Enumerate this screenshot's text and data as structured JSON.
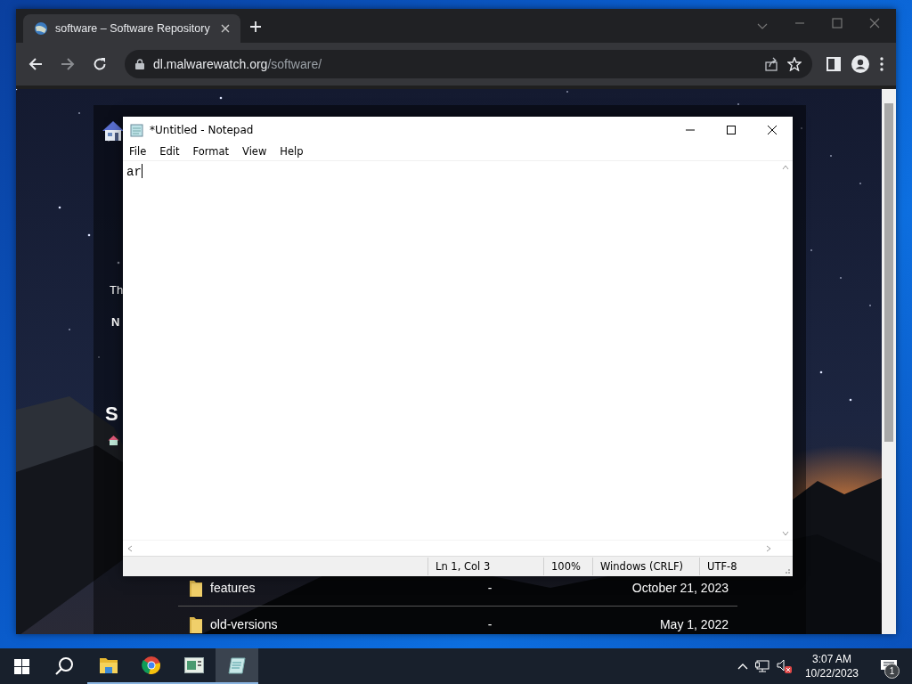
{
  "browser": {
    "tab": {
      "title": "software – Software Repository"
    },
    "address": {
      "host": "dl.malwarewatch.org",
      "path": "/software/"
    }
  },
  "page": {
    "cut_texts": [
      {
        "kind": "plain",
        "text": "Th"
      },
      {
        "kind": "bold",
        "text": "N"
      },
      {
        "kind": "heading",
        "text": "S"
      }
    ],
    "files": [
      {
        "name": "features",
        "size": "-",
        "date": "October 21, 2023"
      },
      {
        "name": "old-versions",
        "size": "-",
        "date": "May 1, 2022"
      }
    ]
  },
  "notepad": {
    "title": "*Untitled - Notepad",
    "menu": [
      "File",
      "Edit",
      "Format",
      "View",
      "Help"
    ],
    "text": "ar",
    "status": [
      "Ln 1, Col 3",
      "100%",
      "Windows (CRLF)",
      "UTF-8"
    ]
  },
  "taskbar": {
    "apps": [
      {
        "kind": "explorer",
        "selected": false
      },
      {
        "kind": "chrome",
        "selected": false
      },
      {
        "kind": "viewer",
        "selected": false
      },
      {
        "kind": "notepad",
        "selected": true
      }
    ],
    "volume_muted": true,
    "time": "3:07 AM",
    "date": "10/22/2023",
    "notifications": "1"
  }
}
